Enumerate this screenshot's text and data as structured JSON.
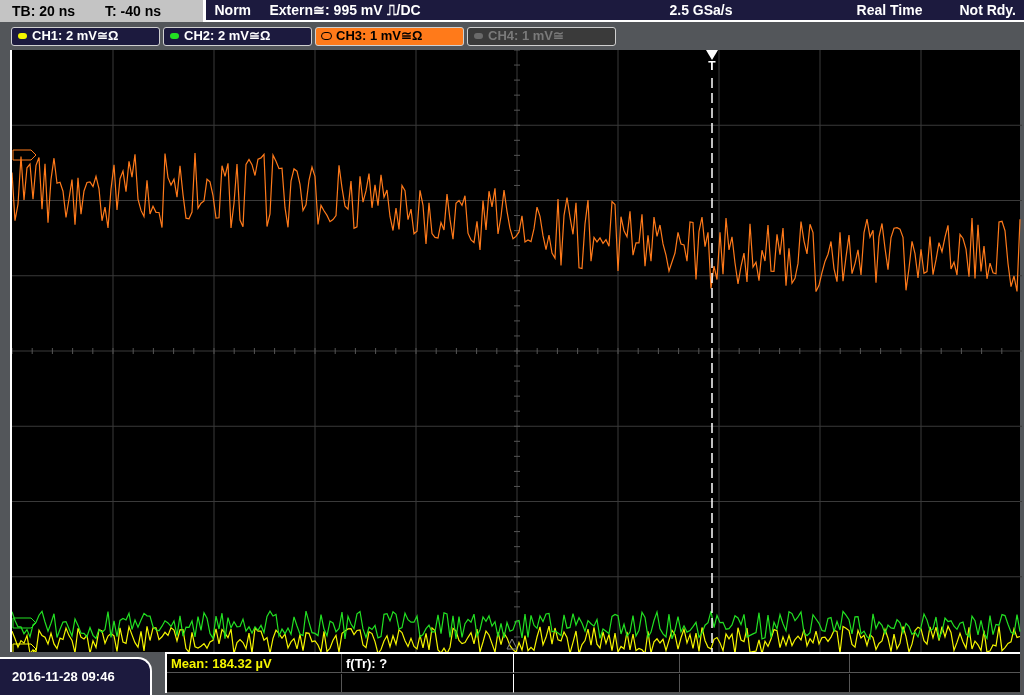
{
  "timebase": {
    "tb": "TB: 20 ns",
    "t": "T: -40 ns"
  },
  "status_bar": {
    "mode": "Norm",
    "trigger_source": "Extern≅: 995 mV ⎍/DC",
    "sample_rate": "2.5 GSa/s",
    "acquisition": "Real Time",
    "state": "Not Rdy."
  },
  "channels": [
    {
      "label": "CH1: 2 mV≅Ω",
      "color": "#f5f500",
      "selected": false,
      "disabled": false
    },
    {
      "label": "CH2: 2 mV≅Ω",
      "color": "#22e022",
      "selected": false,
      "disabled": false
    },
    {
      "label": "CH3: 1 mV≅Ω",
      "color": "#ff7a1a",
      "selected": true,
      "disabled": false
    },
    {
      "label": "CH4: 1 mV≅",
      "color": "#6a6a6a",
      "selected": false,
      "disabled": true
    }
  ],
  "trigger": {
    "label": "T"
  },
  "date_time": "2016-11-28 09:46",
  "measurements": [
    {
      "text": "Mean: 184.32 µV",
      "color": "#f5f500"
    },
    {
      "text": "f(Tr): ?",
      "color": "#ffffff"
    }
  ]
}
